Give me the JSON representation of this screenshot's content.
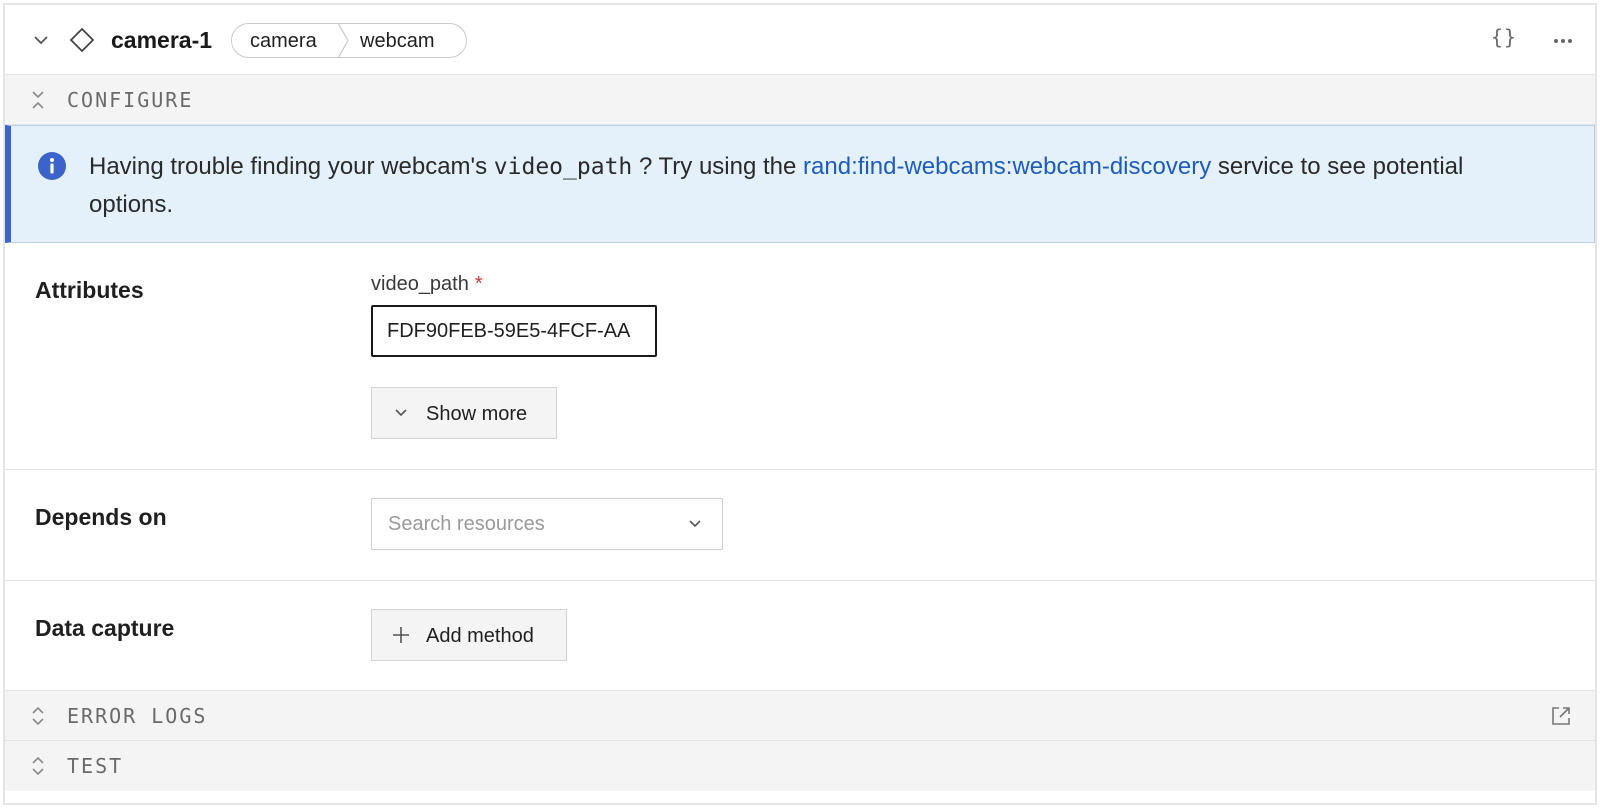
{
  "header": {
    "title": "camera-1",
    "breadcrumb": [
      "camera",
      "webcam"
    ],
    "json_label": "{}",
    "icons": {
      "collapse": "chevron-down-icon",
      "resource": "diamond-icon",
      "more": "more-horizontal-icon"
    }
  },
  "sections": {
    "configure": "CONFIGURE",
    "error_logs": "ERROR LOGS",
    "test": "TEST"
  },
  "banner": {
    "text_before": "Having trouble finding your webcam's ",
    "code": "video_path",
    "text_middle": " ? Try using the ",
    "link": "rand:find-webcams:webcam-discovery",
    "text_after": " service to see potential options."
  },
  "attributes": {
    "label": "Attributes",
    "field_label": "video_path",
    "required_mark": "*",
    "value": "FDF90FEB-59E5-4FCF-AA",
    "show_more": "Show more"
  },
  "depends_on": {
    "label": "Depends on",
    "placeholder": "Search resources"
  },
  "data_capture": {
    "label": "Data capture",
    "add_method": "Add method"
  },
  "colors": {
    "accent": "#3b63c9",
    "link": "#1d5bbf",
    "banner_bg": "#e4f1fb",
    "required": "#d23333"
  }
}
